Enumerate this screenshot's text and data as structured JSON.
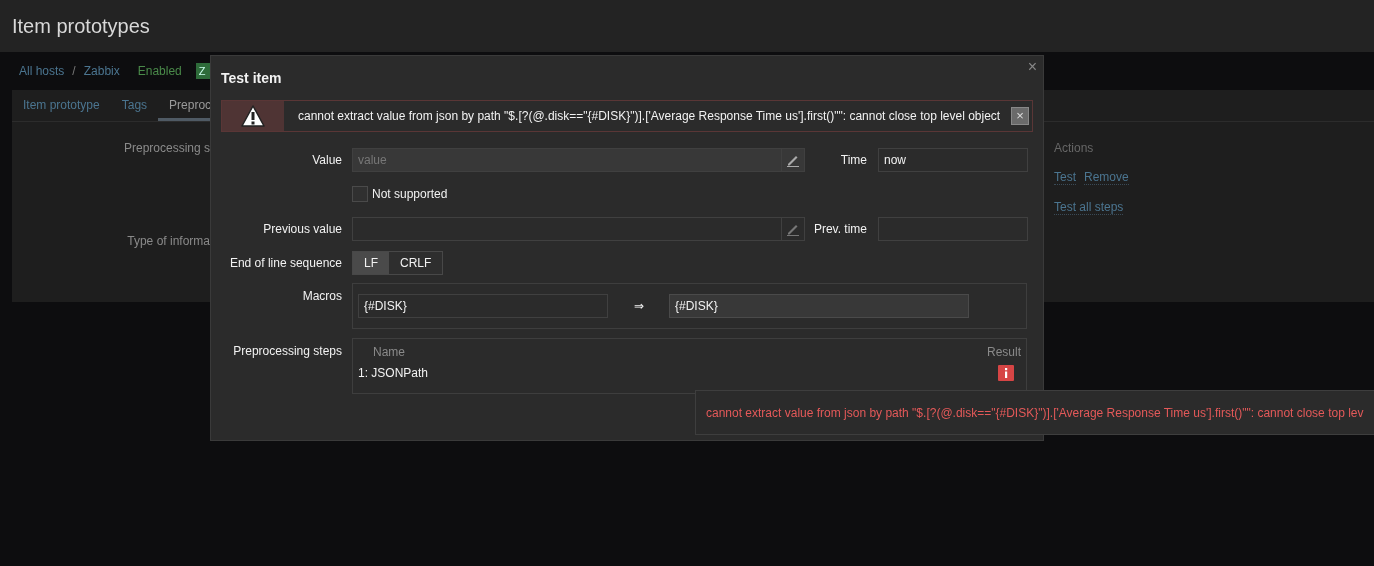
{
  "page": {
    "title": "Item prototypes"
  },
  "breadcrumbs": {
    "items": [
      {
        "label": "All hosts"
      },
      {
        "label": "Zabbix"
      }
    ],
    "separator": "/"
  },
  "host_status": {
    "label": "Enabled",
    "badge": "Z"
  },
  "tabs": [
    {
      "label": "Item prototype",
      "selected": false
    },
    {
      "label": "Tags",
      "selected": false
    },
    {
      "label": "Preproc",
      "selected": true
    }
  ],
  "form": {
    "labels": [
      "Preprocessing s",
      "Type of informa"
    ],
    "actions_header": "Actions",
    "actions": [
      {
        "label": "Test"
      },
      {
        "label": "Remove"
      }
    ],
    "test_all": "Test all steps"
  },
  "dialog": {
    "title": "Test item",
    "close": "×",
    "error": {
      "message": "cannot extract value from json by path \"$.[?(@.disk==\"{#DISK}\")].['Average Response Time us'].first()\"\": cannot close top level object",
      "close": "×"
    },
    "value": {
      "label": "Value",
      "placeholder": "value"
    },
    "time": {
      "label": "Time",
      "value": "now"
    },
    "not_supported": {
      "label": "Not supported",
      "checked": false
    },
    "previous_value": {
      "label": "Previous value"
    },
    "prev_time": {
      "label": "Prev. time"
    },
    "eol": {
      "label": "End of line sequence",
      "options": [
        {
          "label": "LF",
          "selected": true
        },
        {
          "label": "CRLF",
          "selected": false
        }
      ]
    },
    "macros": {
      "label": "Macros",
      "items": [
        {
          "macro": "{#DISK}",
          "arrow": "⇒",
          "value": "{#DISK}"
        }
      ]
    },
    "steps": {
      "label": "Preprocessing steps",
      "columns": [
        "Name",
        "Result"
      ],
      "rows": [
        {
          "name": "1: JSONPath",
          "kind": "error"
        }
      ]
    }
  },
  "tooltip": {
    "message": "cannot extract value from json by path \"$.[?(@.disk==\"{#DISK}\")].['Average Response Time us'].first()\"\": cannot close top lev"
  }
}
